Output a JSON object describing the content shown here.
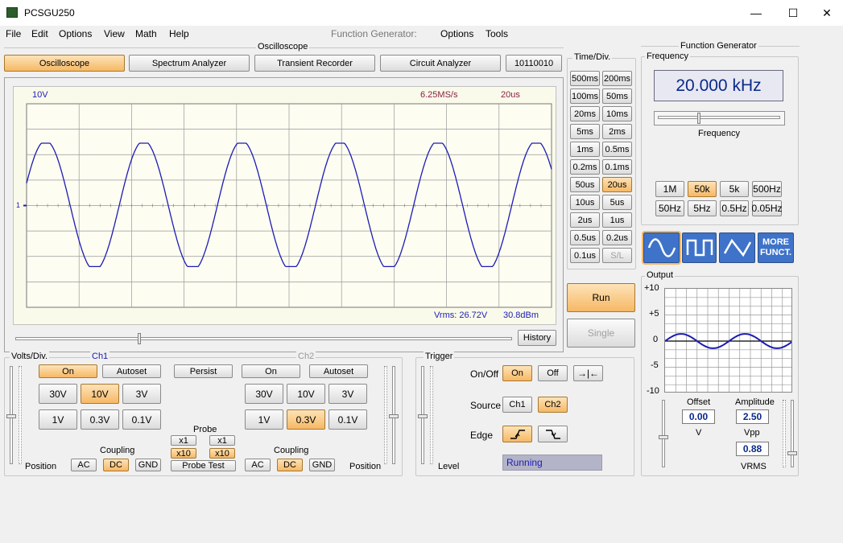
{
  "app": {
    "title": "PCSGU250",
    "minimize": "—",
    "maximize": "☐",
    "close": "✕"
  },
  "menu": [
    "File",
    "Edit",
    "Options",
    "View",
    "Math",
    "Help"
  ],
  "fg_menu": {
    "label": "Function Generator:",
    "options": "Options",
    "tools": "Tools"
  },
  "oscilloscope": {
    "group_label": "Oscilloscope",
    "tabs": [
      "Oscilloscope",
      "Spectrum Analyzer",
      "Transient Recorder",
      "Circuit Analyzer",
      "10110010"
    ],
    "screen": {
      "volts": "10V",
      "sample_rate": "6.25MS/s",
      "timebase": "20us",
      "ch_marker": "1",
      "vrms": "Vrms: 26.72V",
      "dbm": "30.8dBm"
    },
    "history": "History",
    "waveform": {
      "cycles": 5.35,
      "amplitude_div": 2.5,
      "divisions_x": 10,
      "divisions_y": 8
    }
  },
  "timediv": {
    "label": "Time/Div.",
    "buttons": [
      [
        "500ms",
        "200ms"
      ],
      [
        "100ms",
        "50ms"
      ],
      [
        "20ms",
        "10ms"
      ],
      [
        "5ms",
        "2ms"
      ],
      [
        "1ms",
        "0.5ms"
      ],
      [
        "0.2ms",
        "0.1ms"
      ],
      [
        "50us",
        "20us"
      ],
      [
        "10us",
        "5us"
      ],
      [
        "2us",
        "1us"
      ],
      [
        "0.5us",
        "0.2us"
      ],
      [
        "0.1us",
        "S/L"
      ]
    ],
    "selected": "20us",
    "run": "Run",
    "single": "Single"
  },
  "volts": {
    "label": "Volts/Div.",
    "ch1": "Ch1",
    "ch2": "Ch2",
    "on": "On",
    "autoset": "Autoset",
    "persist": "Persist",
    "ranges": [
      "30V",
      "10V",
      "3V",
      "1V",
      "0.3V",
      "0.1V"
    ],
    "ch1_selected": "10V",
    "ch2_selected": "0.3V",
    "probe": "Probe",
    "x1": "x1",
    "x10": "x10",
    "probe_test": "Probe Test",
    "coupling": "Coupling",
    "ac": "AC",
    "dc": "DC",
    "gnd": "GND",
    "position": "Position"
  },
  "trigger": {
    "label": "Trigger",
    "onoff": "On/Off",
    "on": "On",
    "off": "Off",
    "source": "Source",
    "ch1": "Ch1",
    "ch2": "Ch2",
    "edge": "Edge",
    "level": "Level",
    "status": "Running"
  },
  "fg": {
    "group_label": "Function Generator",
    "freq_label": "Frequency",
    "freq_value": "20.000 kHz",
    "freq_slider_label": "Frequency",
    "ranges": [
      "1M",
      "50k",
      "5k",
      "500Hz",
      "50Hz",
      "5Hz",
      "0.5Hz",
      "0.05Hz"
    ],
    "range_selected": "50k",
    "more": "MORE FUNCT."
  },
  "output": {
    "label": "Output",
    "yticks": [
      "+10",
      "+5",
      "0",
      "-5",
      "-10"
    ],
    "offset_label": "Offset",
    "offset": "0.00",
    "offset_unit": "V",
    "amp_label": "Amplitude",
    "amp": "2.50",
    "amp_unit": "Vpp",
    "vrms": "0.88",
    "vrms_unit": "VRMS"
  },
  "colors": {
    "trace": "#1c1cb4",
    "accent": "#f6b865",
    "grid": "#8c8c8c"
  }
}
